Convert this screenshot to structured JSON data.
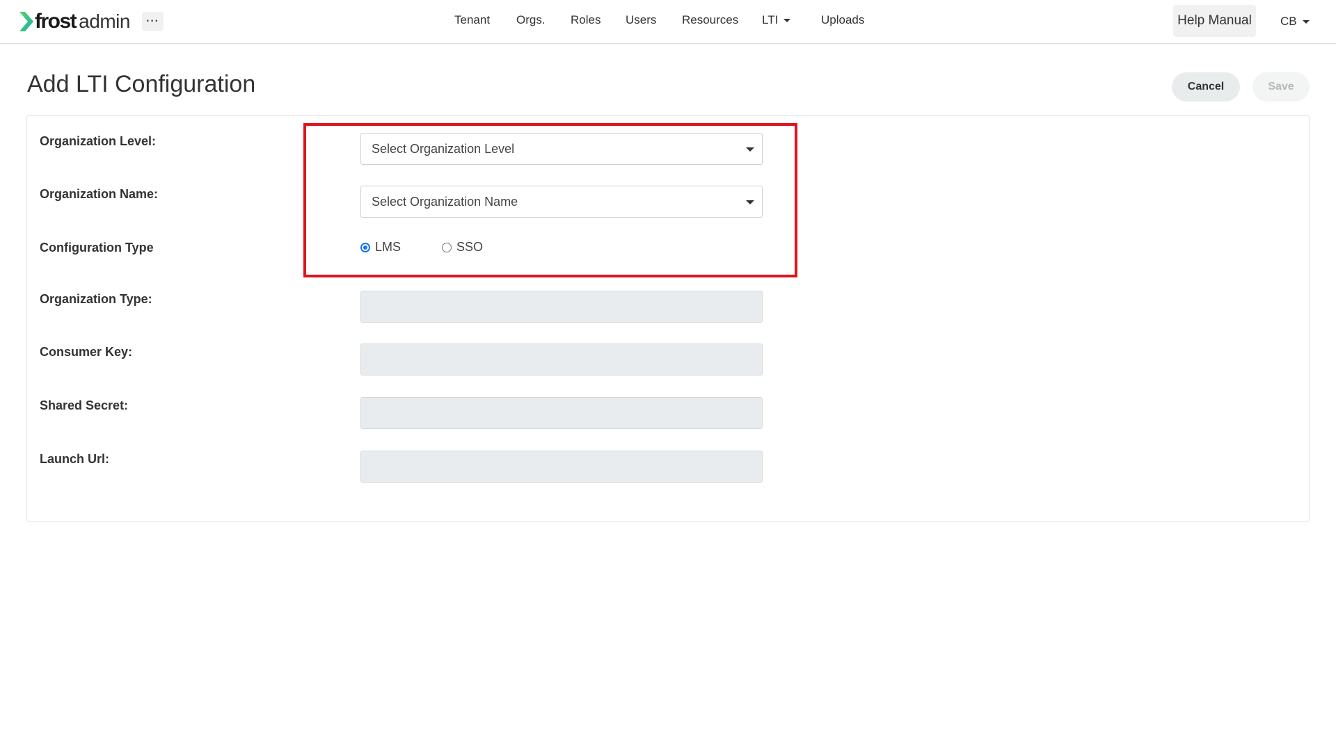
{
  "header": {
    "logo_word": "frost",
    "logo_sub": "admin",
    "more_label": "···",
    "nav": [
      {
        "label": "Tenant"
      },
      {
        "label": "Orgs."
      },
      {
        "label": "Roles"
      },
      {
        "label": "Users"
      },
      {
        "label": "Resources"
      },
      {
        "label": "LTI"
      },
      {
        "label": "Uploads"
      }
    ],
    "help_label": "Help Manual",
    "user_initials": "CB"
  },
  "page": {
    "title": "Add LTI Configuration",
    "cancel_label": "Cancel",
    "save_label": "Save"
  },
  "form": {
    "org_level": {
      "label": "Organization Level:",
      "value": "Select Organization Level"
    },
    "org_name": {
      "label": "Organization Name:",
      "value": "Select Organization Name"
    },
    "config_type": {
      "label": "Configuration Type",
      "options": [
        {
          "label": "LMS",
          "checked": true
        },
        {
          "label": "SSO",
          "checked": false
        }
      ]
    },
    "org_type": {
      "label": "Organization Type:",
      "value": ""
    },
    "consumer_key": {
      "label": "Consumer Key:",
      "value": ""
    },
    "shared_secret": {
      "label": "Shared Secret:",
      "value": ""
    },
    "launch_url": {
      "label": "Launch Url:",
      "value": ""
    }
  },
  "colors": {
    "brand_green": "#2ec27e",
    "highlight_red": "#e0141e",
    "radio_blue": "#1a73e8"
  }
}
